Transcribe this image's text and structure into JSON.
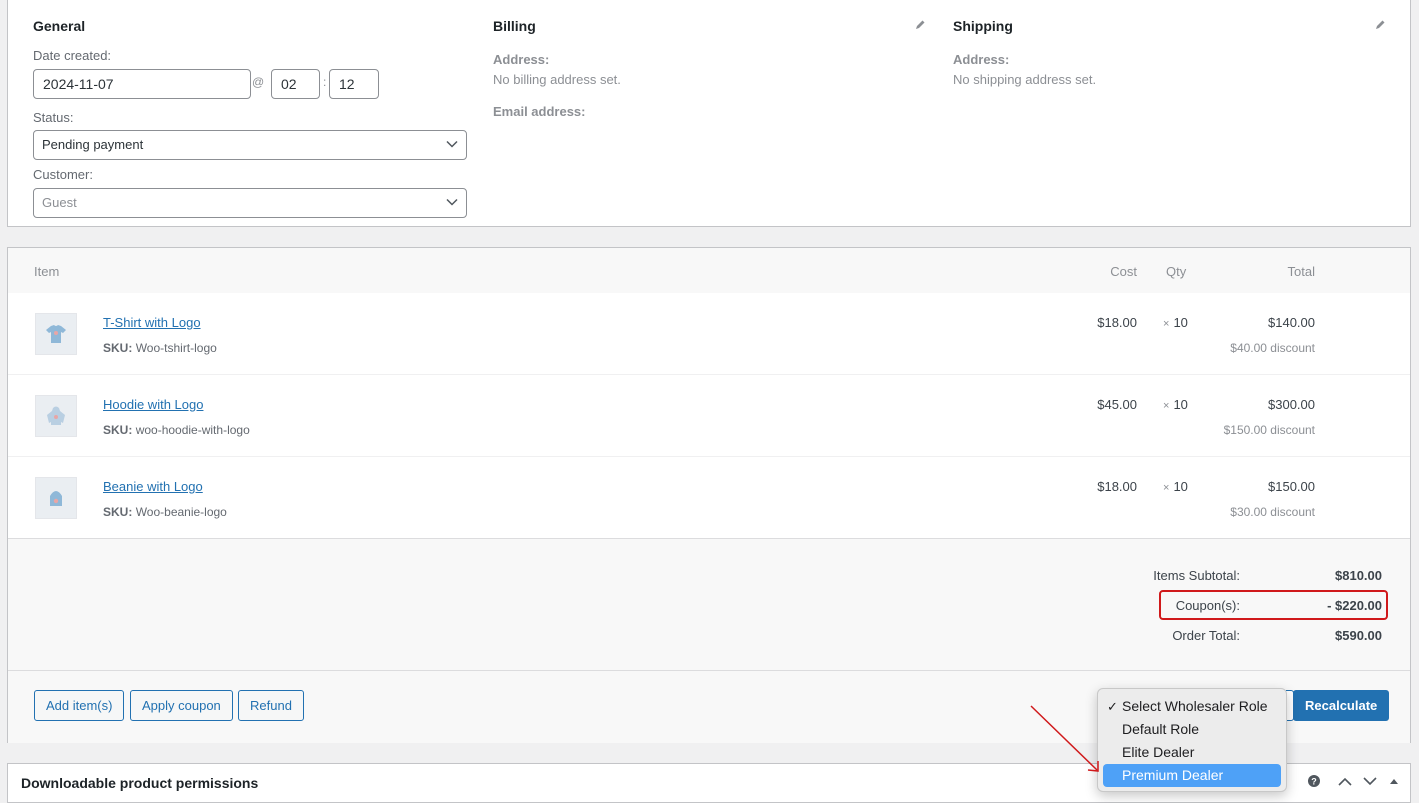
{
  "general": {
    "title": "General",
    "date_created_label": "Date created:",
    "date_value": "2024-11-07",
    "at_sign": "@",
    "hour_value": "02",
    "time_sep": ":",
    "minute_value": "12",
    "status_label": "Status:",
    "status_value": "Pending payment",
    "customer_label": "Customer:",
    "customer_placeholder": "Guest"
  },
  "billing": {
    "title": "Billing",
    "address_label": "Address:",
    "address_value": "No billing address set.",
    "email_label": "Email address:"
  },
  "shipping": {
    "title": "Shipping",
    "address_label": "Address:",
    "address_value": "No shipping address set."
  },
  "items_table": {
    "headers": {
      "item": "Item",
      "cost": "Cost",
      "qty": "Qty",
      "total": "Total"
    },
    "sku_label": "SKU:",
    "qty_prefix": "×",
    "rows": [
      {
        "name": "T-Shirt with Logo",
        "sku": "Woo-tshirt-logo",
        "cost": "$18.00",
        "qty": "10",
        "total": "$140.00",
        "discount": "$40.00 discount",
        "thumb_icon": "tshirt-icon"
      },
      {
        "name": "Hoodie with Logo",
        "sku": "woo-hoodie-with-logo",
        "cost": "$45.00",
        "qty": "10",
        "total": "$300.00",
        "discount": "$150.00 discount",
        "thumb_icon": "hoodie-icon"
      },
      {
        "name": "Beanie with Logo",
        "sku": "Woo-beanie-logo",
        "cost": "$18.00",
        "qty": "10",
        "total": "$150.00",
        "discount": "$30.00 discount",
        "thumb_icon": "beanie-icon"
      }
    ]
  },
  "totals": {
    "subtotal_label": "Items Subtotal:",
    "subtotal_value": "$810.00",
    "coupons_label": "Coupon(s):",
    "coupons_value": "- $220.00",
    "order_total_label": "Order Total:",
    "order_total_value": "$590.00",
    "highlight_color": "#d0191b"
  },
  "actions": {
    "add_items": "Add item(s)",
    "apply_coupon": "Apply coupon",
    "refund": "Refund",
    "recalculate": "Recalculate"
  },
  "wholesaler_role_dropdown": {
    "check_mark": "✓",
    "options": [
      "Select Wholesaler Role",
      "Default Role",
      "Elite Dealer",
      "Premium Dealer"
    ],
    "checked_option": "Select Wholesaler Role",
    "highlighted_option": "Premium Dealer",
    "highlight_color": "#4ea1f7"
  },
  "downloads": {
    "title": "Downloadable product permissions",
    "icons": [
      "help-icon",
      "move-up-icon",
      "move-down-icon",
      "toggle-panel-icon"
    ]
  },
  "colors": {
    "accent": "#2271b1",
    "annotation_arrow": "#d0191b"
  }
}
